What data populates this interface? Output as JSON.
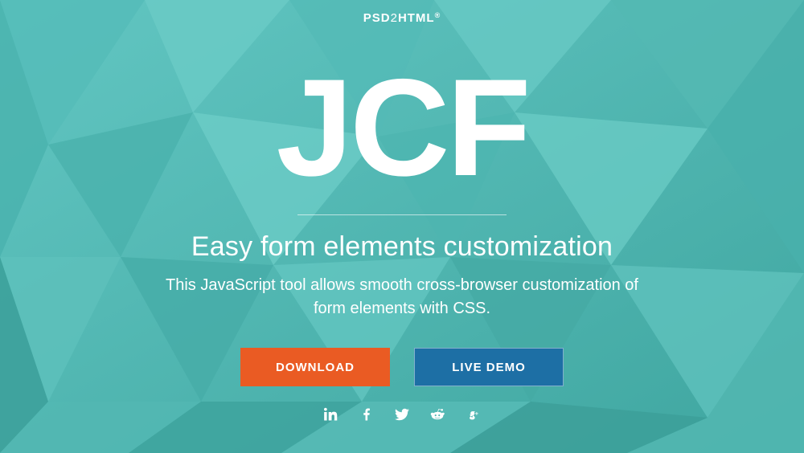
{
  "brand": {
    "part1": "PSD",
    "part2": "2",
    "part3": "HTML",
    "reg": "®"
  },
  "hero": {
    "title": "JCF",
    "subtitle": "Easy form elements customization",
    "description": "This JavaScript tool allows smooth cross-browser customization of form elements with CSS."
  },
  "cta": {
    "download": "DOWNLOAD",
    "demo": "LIVE DEMO"
  },
  "social": [
    "linkedin",
    "facebook",
    "twitter",
    "reddit",
    "googleplus"
  ],
  "colors": {
    "primary_button": "#ea5b23",
    "secondary_button": "#1d6fa5"
  }
}
